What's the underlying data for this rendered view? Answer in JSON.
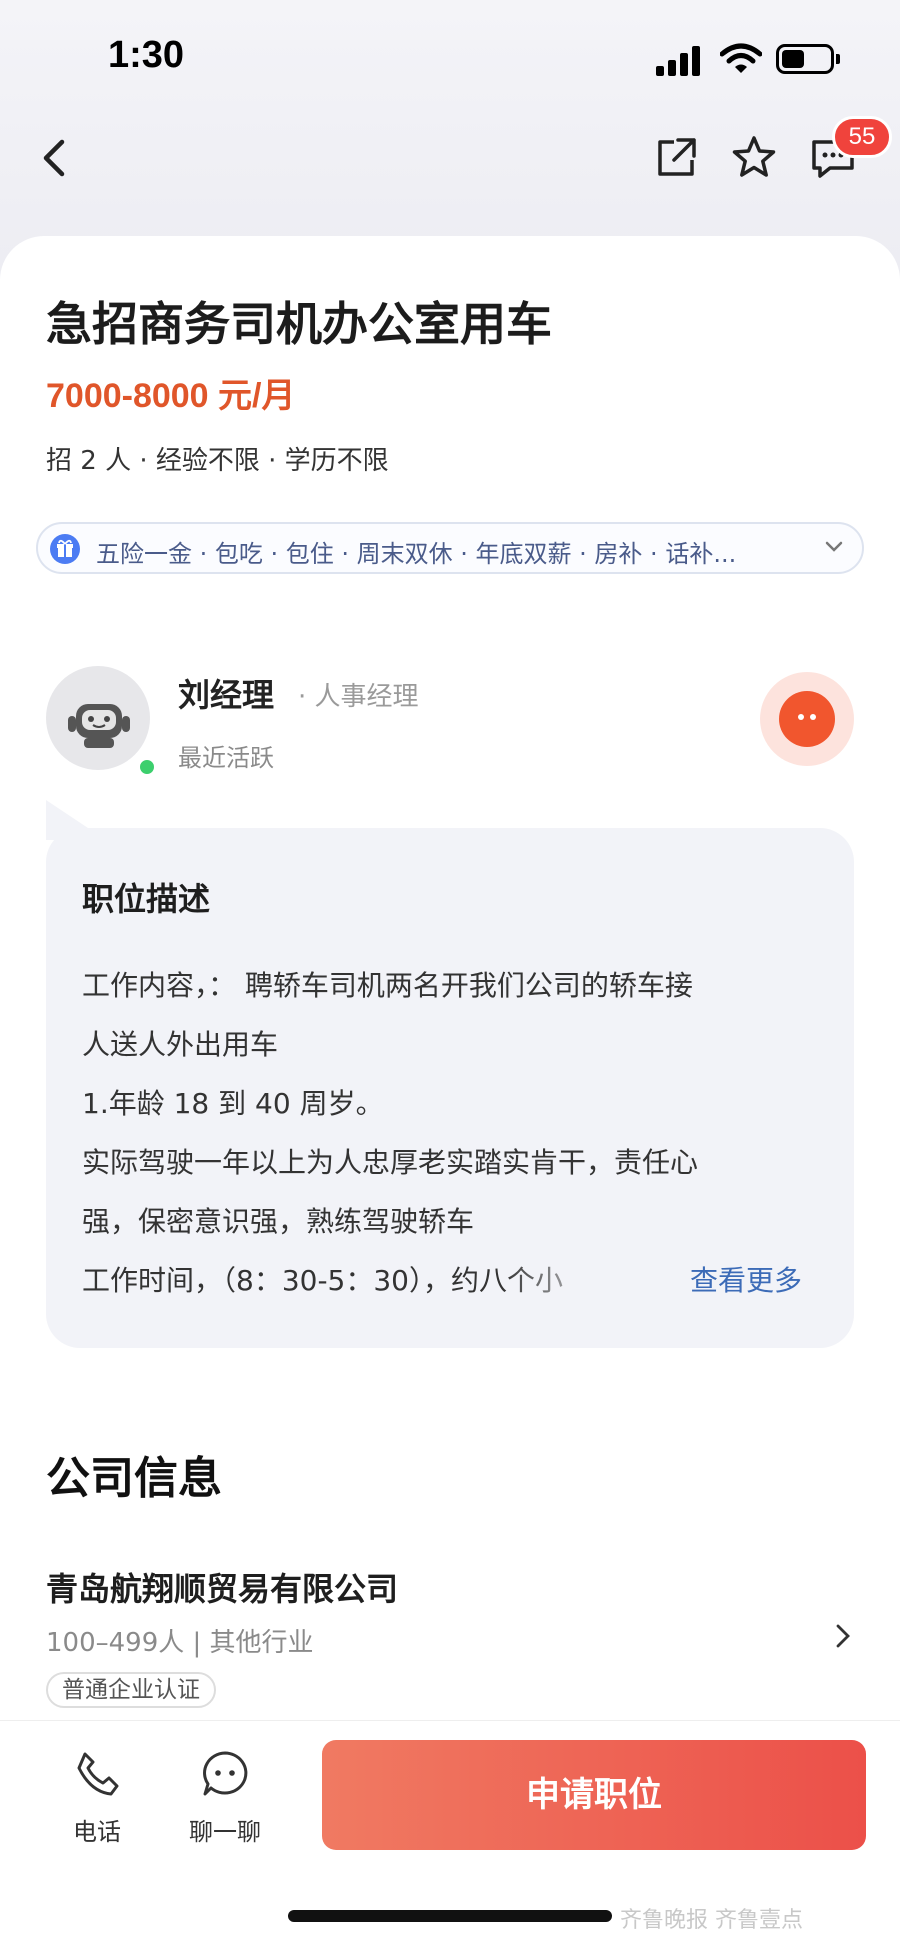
{
  "status_bar": {
    "time": "1:30"
  },
  "nav": {
    "message_badge": "55"
  },
  "job": {
    "title": "急招商务司机办公室用车",
    "salary": "7000-8000 元/月",
    "requirements": "招 2 人 · 经验不限 · 学历不限",
    "welfare": "五险一金 · 包吃 · 包住 · 周末双休 · 年底双薪 · 房补 · 话补..."
  },
  "recruiter": {
    "name": "刘经理",
    "role": "· 人事经理",
    "status": "最近活跃"
  },
  "description": {
    "title": "职位描述",
    "lines": [
      "工作内容，： 聘轿车司机两名开我们公司的轿车接",
      "人送人外出用车",
      "1.年龄 18 到 40 周岁。",
      "实际驾驶一年以上为人忠厚老实踏实肯干，责任心",
      "强，保密意识强，熟练驾驶轿车"
    ],
    "last_line": "工作时间，（8：30-5：30），约八个小",
    "see_more": "查看更多"
  },
  "company": {
    "section_title": "公司信息",
    "name": "青岛航翔顺贸易有限公司",
    "meta": "100–499人 | 其他行业",
    "badge": "普通企业认证"
  },
  "bottom_bar": {
    "phone_label": "电话",
    "chat_label": "聊一聊",
    "apply_label": "申请职位"
  },
  "watermark": "齐鲁晚报  齐鲁壹点",
  "colors": {
    "accent": "#e0562a",
    "apply_start": "#f07a62",
    "apply_end": "#ec5049",
    "link": "#3c6bb7",
    "badge": "#f0433c",
    "online": "#3ccf6d"
  }
}
